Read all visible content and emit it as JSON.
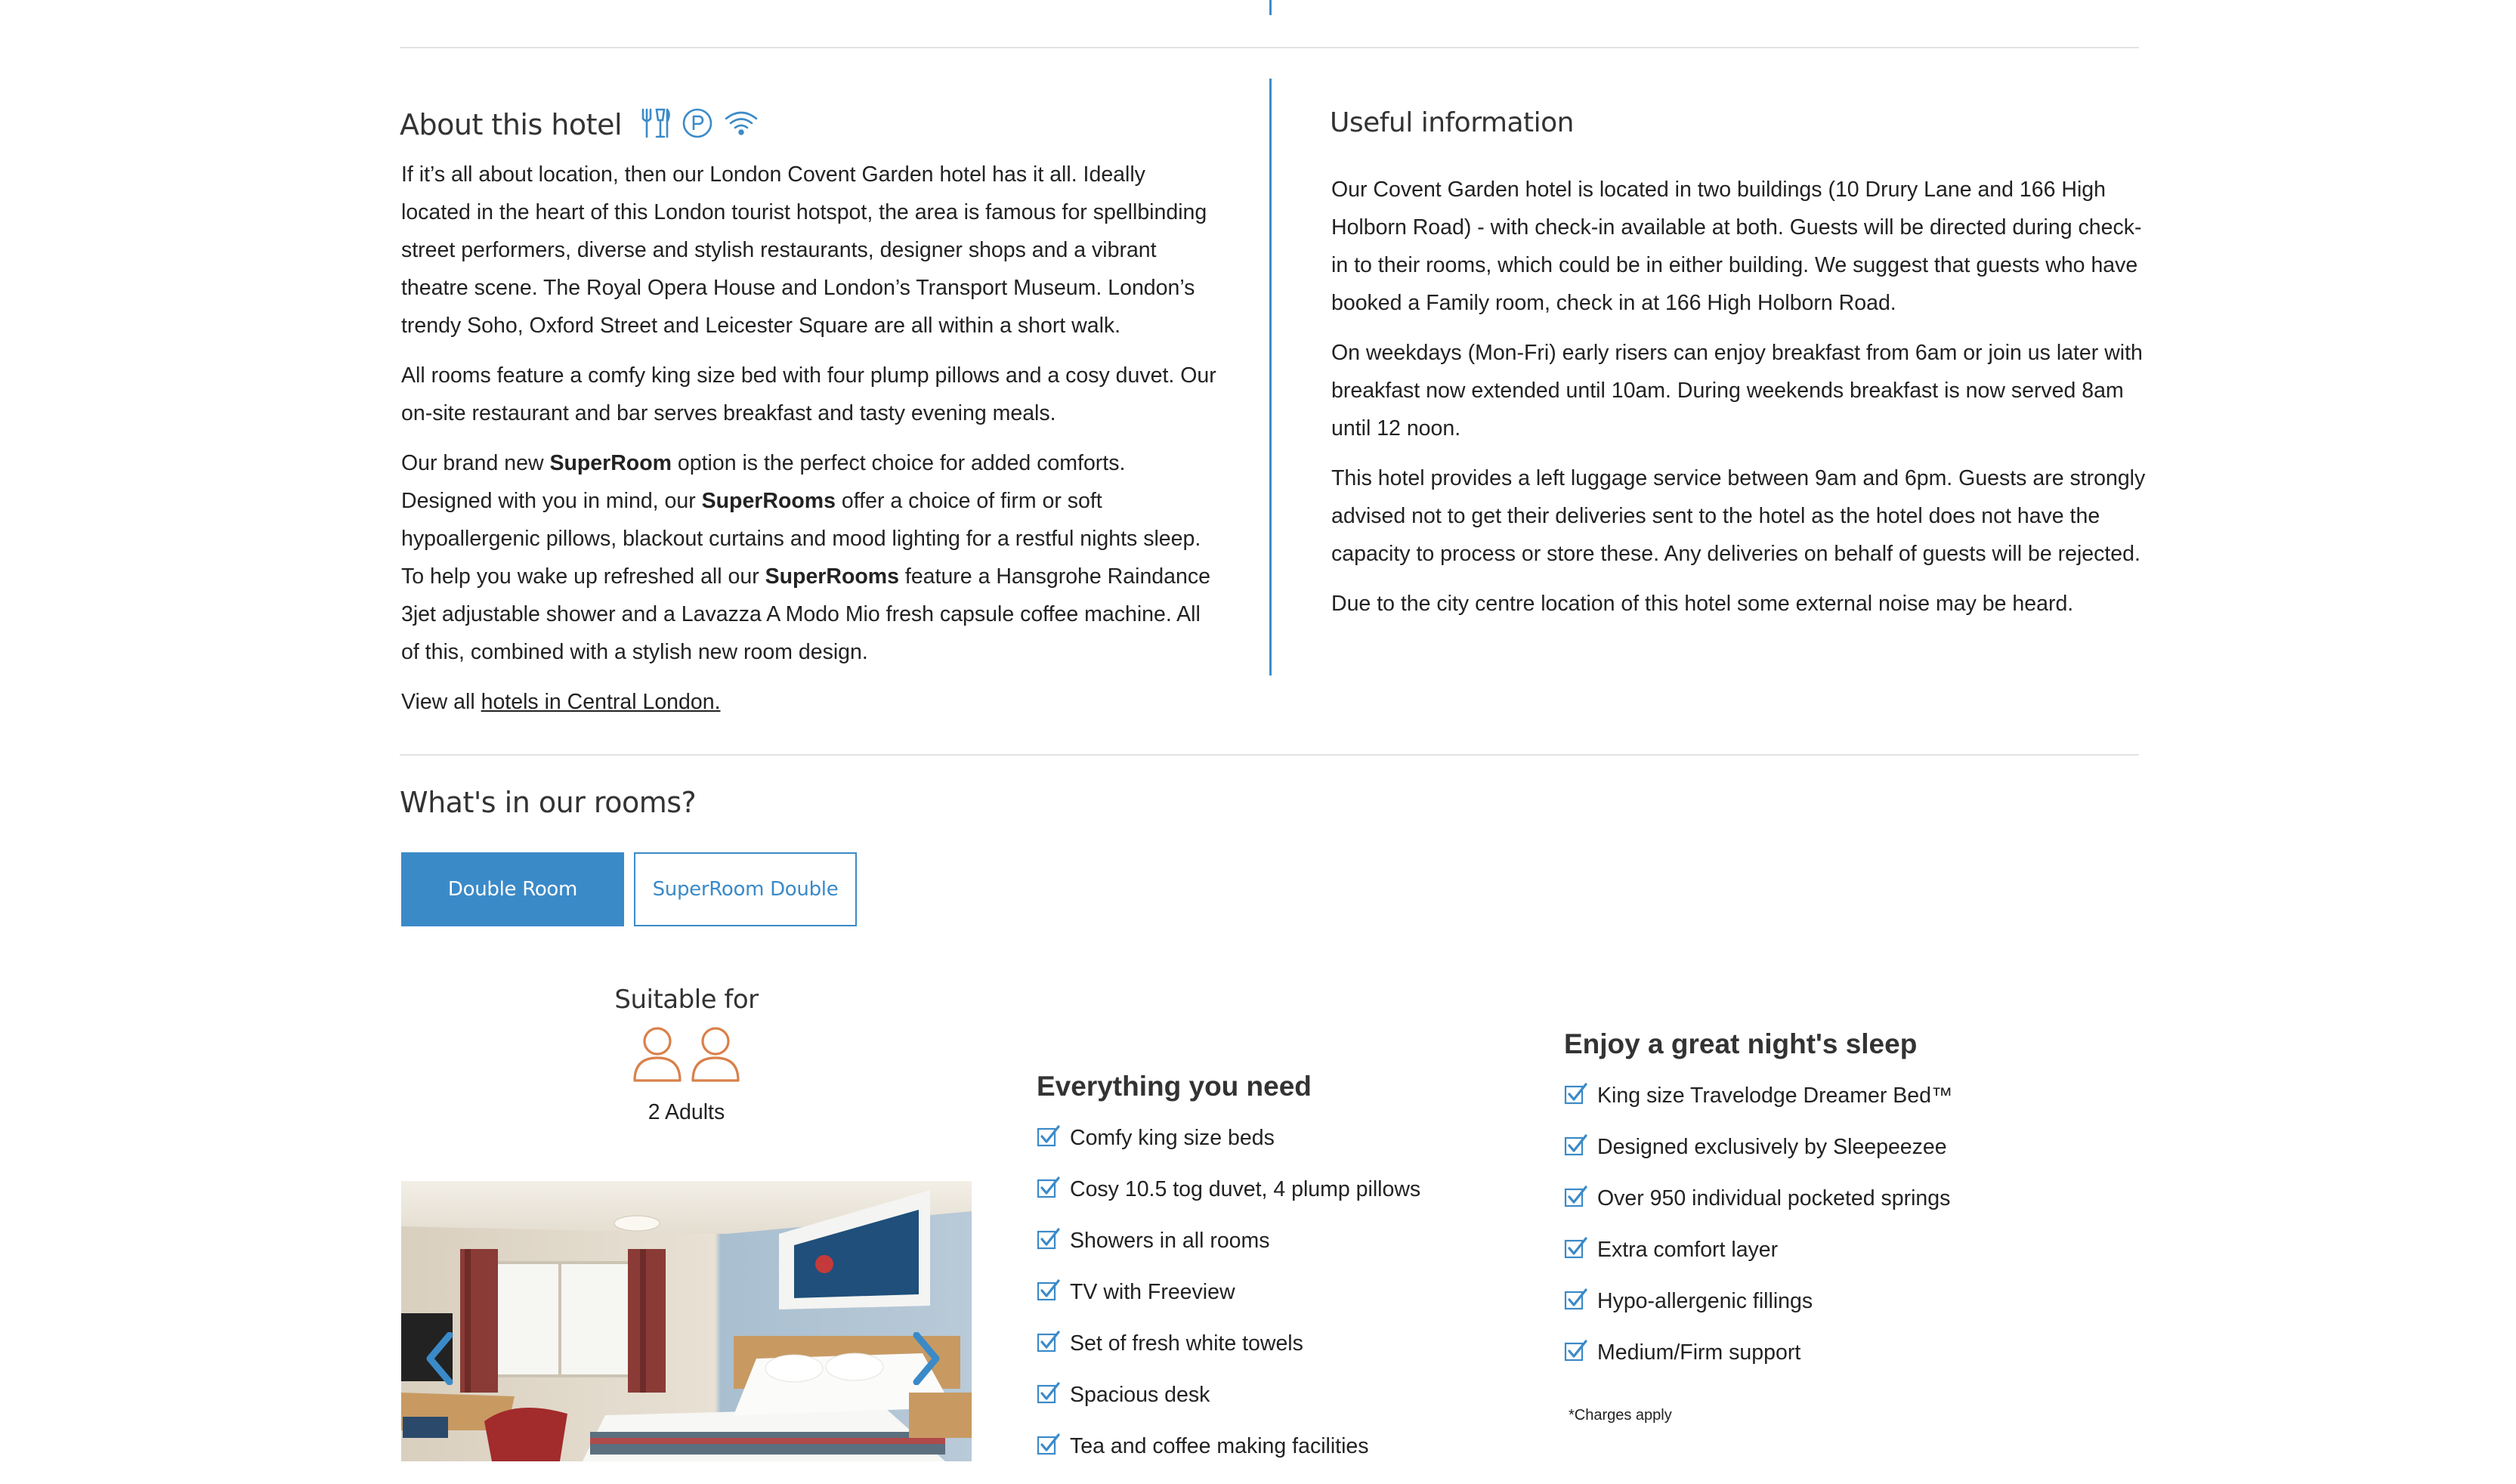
{
  "about": {
    "title": "About this hotel",
    "paragraphs": [
      "If it’s all about location, then our London Covent Garden hotel has it all. Ideally located in the heart of this London tourist hotspot, the area is famous for spellbinding street performers, diverse and stylish restaurants, designer shops and a vibrant theatre scene. The Royal Opera House and London’s Transport Museum. London’s trendy Soho, Oxford Street and Leicester Square are all within a short walk.",
      "All rooms feature a comfy king size bed with four plump pillows and a cosy duvet. Our on-site restaurant and bar serves breakfast and tasty evening meals."
    ],
    "superroom": {
      "t1": "Our brand new ",
      "b1": "SuperRoom",
      "t2": " option is the perfect choice for added comforts. Designed with you in mind, our ",
      "b2": "SuperRooms",
      "t3": " offer a choice of firm or soft hypoallergenic pillows, blackout curtains and mood lighting for a restful nights sleep. To help you wake up refreshed all our ",
      "b3": "SuperRooms",
      "t4": " feature a Hansgrohe Raindance 3jet adjustable shower and a Lavazza A Modo Mio fresh capsule coffee machine. All of this, combined with a stylish new room design."
    },
    "view_all_prefix": "View all ",
    "view_all_link": "hotels in Central London.",
    "amenity_icons": [
      "restaurant-icon",
      "parking-icon",
      "wifi-icon"
    ]
  },
  "useful": {
    "title": "Useful information",
    "paragraphs": [
      "Our Covent Garden hotel is located in two buildings (10 Drury Lane and 166 High Holborn Road) - with check-in available at both. Guests will be directed during check-in to their rooms, which could be in either building. We suggest that guests who have booked a Family room, check in at 166 High Holborn Road.",
      "On weekdays (Mon-Fri) early risers can enjoy breakfast from 6am or join us later with breakfast now extended until 10am. During weekends breakfast is now served 8am until 12 noon.",
      "This hotel provides a left luggage service between 9am and 6pm. Guests are strongly advised not to get their deliveries sent to the hotel as the hotel does not have the capacity to process or store these. Any deliveries on behalf of guests will be rejected.",
      "Due to the city centre location of this hotel some external noise may be heard."
    ]
  },
  "rooms": {
    "title": "What's in our rooms?",
    "tabs": [
      {
        "label": "Double Room",
        "active": true
      },
      {
        "label": "SuperRoom Double",
        "active": false
      }
    ],
    "suitable_label": "Suitable for",
    "occupancy": "2 Adults",
    "person_icon_color": "#d9804a",
    "everything": {
      "title": "Everything you need",
      "items": [
        "Comfy king size beds",
        "Cosy 10.5 tog duvet, 4 plump pillows",
        "Showers in all rooms",
        "TV with Freeview",
        "Set of fresh white towels",
        "Spacious desk",
        "Tea and coffee making facilities"
      ]
    },
    "sleep": {
      "title": "Enjoy a great night's sleep",
      "items": [
        "King size Travelodge Dreamer Bed™",
        "Designed exclusively by Sleepeezee",
        "Over 950 individual pocketed springs",
        "Extra comfort layer",
        "Hypo-allergenic fillings",
        "Medium/Firm support"
      ],
      "note": "*Charges apply"
    }
  },
  "colors": {
    "accent": "#3b8ac8",
    "divider": "#e3e3e3"
  }
}
